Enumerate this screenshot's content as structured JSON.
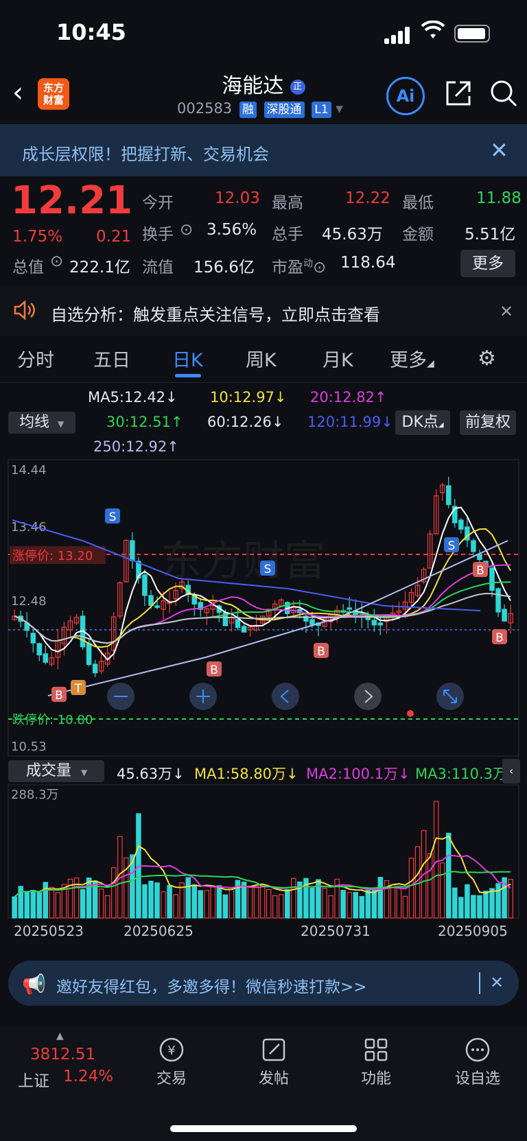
{
  "status": {
    "time": "10:45"
  },
  "header": {
    "title": "海能达",
    "badge": "正",
    "code": "002583",
    "tags": [
      "融",
      "深股通",
      "L1"
    ],
    "logo": "东方财富",
    "ai_label": "Ai"
  },
  "banner": {
    "text": "成长层权限！把握打新、交易机会"
  },
  "quote": {
    "price": "12.21",
    "change_pct": "1.75%",
    "change": "0.21",
    "open_label": "今开",
    "open": "12.03",
    "high_label": "最高",
    "high": "12.22",
    "low_label": "最低",
    "low": "11.88",
    "turnover_label": "换手",
    "turnover": "3.56%",
    "volume_label": "总手",
    "volume": "45.63万",
    "amount_label": "金额",
    "amount": "5.51亿",
    "mktcap_label": "总值",
    "mktcap": "222.1亿",
    "float_label": "流值",
    "float": "156.6亿",
    "pe_label": "市盈",
    "pe_sup": "动",
    "pe": "118.64",
    "more": "更多"
  },
  "notice": {
    "text": "自选分析：触发重点关注信号，立即点击查看"
  },
  "tabs": [
    "分时",
    "五日",
    "日K",
    "周K",
    "月K",
    "更多"
  ],
  "active_tab": "日K",
  "ma": {
    "selector": "均线",
    "ma5": "MA5:12.42↓",
    "ma10": "10:12.97↓",
    "ma20": "20:12.82↑",
    "ma30": "30:12.51↑",
    "ma60": "60:12.26↓",
    "ma120": "120:11.99↓",
    "ma250": "250:12.92↑",
    "dk": "DK点",
    "adjust": "前复权"
  },
  "chart": {
    "y_labels": [
      "14.44",
      "13.46",
      "12.48",
      "10.53"
    ],
    "limit_up": "涨停价: 13.20",
    "limit_down": "跌停价: 10.80",
    "volume_selector": "成交量",
    "vol_value": "45.63万↓",
    "vol_ma1": "MA1:58.80万↓",
    "vol_ma2": "MA2:100.1万↓",
    "vol_ma3": "MA3:110.3万↓",
    "vol_max": "288.3万",
    "dates": [
      "20250523",
      "20250625",
      "20250731",
      "20250905"
    ],
    "signals": [
      "S",
      "S",
      "S",
      "B",
      "B",
      "B",
      "B",
      "B",
      "T"
    ]
  },
  "promo": {
    "text": "邀好友得红包，多邀多得！微信秒速打款>>"
  },
  "bottom": {
    "index_value": "3812.51",
    "index_name": "上证",
    "index_change": "1.24%",
    "nav": [
      "交易",
      "发帖",
      "功能",
      "设自选"
    ]
  },
  "colors": {
    "up": "#f03c3c",
    "down": "#2fd5d5",
    "accent": "#3c8cff"
  }
}
